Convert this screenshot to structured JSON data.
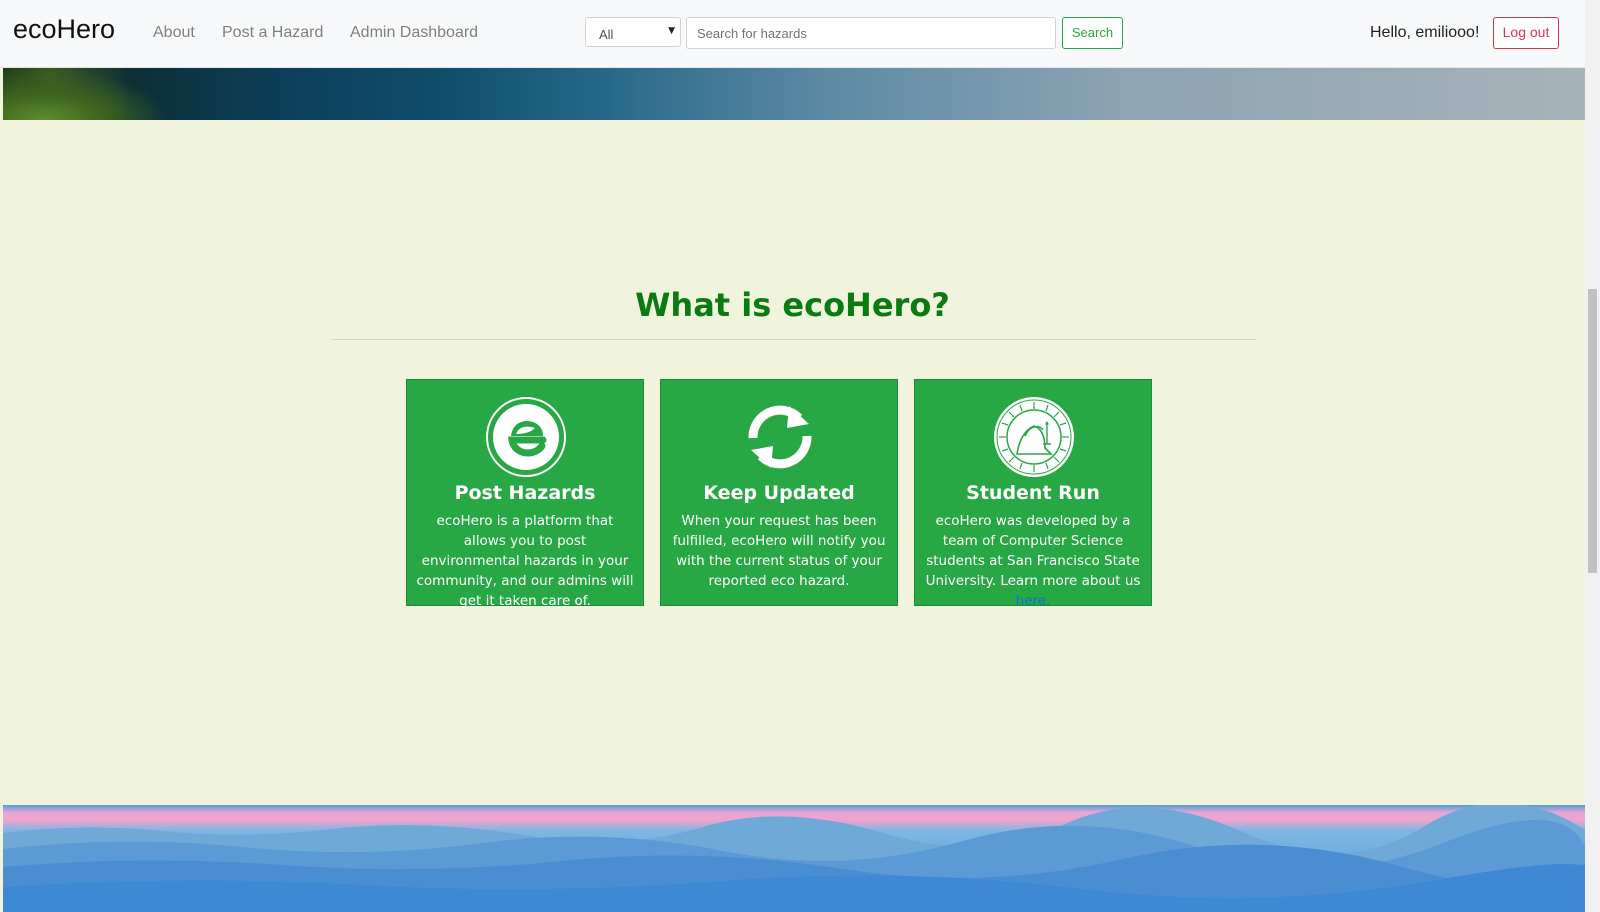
{
  "navbar": {
    "brand": "ecoHero",
    "links": [
      "About",
      "Post a Hazard",
      "Admin Dashboard"
    ],
    "category_select": {
      "value": "All"
    },
    "search": {
      "placeholder": "Search for hazards",
      "button_label": "Search"
    },
    "greeting": "Hello, emiliooo!",
    "logout_label": "Log out"
  },
  "section": {
    "title": "What is ecoHero?",
    "cards": [
      {
        "icon": "ecohero-logo-icon",
        "title": "Post Hazards",
        "text": "ecoHero is a platform that allows you to post environmental hazards in your community, and our admins will get it taken care of."
      },
      {
        "icon": "refresh-icon",
        "title": "Keep Updated",
        "text": "When your request has been fulfilled, ecoHero will notify you with the current status of your reported eco hazard."
      },
      {
        "icon": "sfsu-seal-icon",
        "title": "Student Run",
        "text": "ecoHero was developed by a team of Computer Science students at San Francisco State University. Learn more about us",
        "link_text": "here."
      }
    ]
  },
  "colors": {
    "brand_green": "#28a745",
    "title_green": "#0a7a12",
    "page_background": "#f0f4dc",
    "logout_red": "#dc3545"
  }
}
